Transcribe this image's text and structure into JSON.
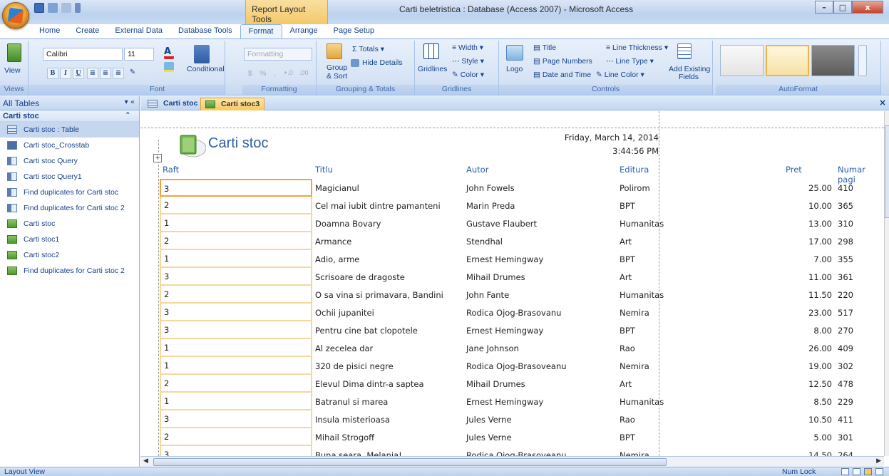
{
  "title_bar": {
    "context_label": "Report Layout Tools",
    "window_title": "Carti beletristica : Database (Access 2007) - Microsoft Access"
  },
  "ribbon_tabs": [
    "Home",
    "Create",
    "External Data",
    "Database Tools",
    "Format",
    "Arrange",
    "Page Setup"
  ],
  "active_tab": "Format",
  "ribbon": {
    "views": {
      "view_label": "View",
      "group_label": "Views"
    },
    "font": {
      "font_name": "Calibri",
      "font_size": "11",
      "bold": "B",
      "italic": "I",
      "underline": "U",
      "conditional": "Conditional",
      "group_label": "Font"
    },
    "formatting": {
      "format_combo": "Formatting",
      "currency": "$",
      "percent": "%",
      "comma": ",",
      "inc_dec": "+.0",
      "dec_dec": ".00",
      "group_label": "Formatting"
    },
    "grouping": {
      "totals": "Totals",
      "hide_details": "Hide Details",
      "group_sort_1": "Group",
      "group_sort_2": "& Sort",
      "group_label": "Grouping & Totals"
    },
    "gridlines": {
      "gridlines": "Gridlines",
      "width": "Width",
      "style": "Style",
      "color": "Color",
      "group_label": "Gridlines"
    },
    "controls": {
      "logo": "Logo",
      "title": "Title",
      "page_numbers": "Page Numbers",
      "date_time": "Date and Time",
      "line_thickness": "Line Thickness",
      "line_type": "Line Type",
      "line_color": "Line Color",
      "add_fields_1": "Add Existing",
      "add_fields_2": "Fields",
      "group_label": "Controls"
    },
    "autoformat": {
      "group_label": "AutoFormat"
    }
  },
  "nav": {
    "header": "All Tables",
    "group": "Carti stoc",
    "items": [
      {
        "label": "Carti stoc : Table",
        "type": "table",
        "selected": true
      },
      {
        "label": "Carti stoc_Crosstab",
        "type": "xtab"
      },
      {
        "label": "Carti stoc Query",
        "type": "query"
      },
      {
        "label": "Carti stoc Query1",
        "type": "query"
      },
      {
        "label": "Find duplicates for Carti stoc",
        "type": "query"
      },
      {
        "label": "Find duplicates for Carti stoc 2",
        "type": "query"
      },
      {
        "label": "Carti stoc",
        "type": "report"
      },
      {
        "label": "Carti stoc1",
        "type": "report"
      },
      {
        "label": "Carti stoc2",
        "type": "report"
      },
      {
        "label": "Find duplicates for Carti stoc 2",
        "type": "report"
      }
    ]
  },
  "doc_tabs": [
    "Carti stoc",
    "Carti stoc3"
  ],
  "report": {
    "title": "Carti stoc",
    "date": "Friday, March 14, 2014",
    "time": "3:44:56 PM",
    "columns": [
      "Raft",
      "Titlu",
      "Autor",
      "Editura",
      "Pret",
      "Numar pagi"
    ],
    "rows": [
      [
        "3",
        "Magicianul",
        "John Fowels",
        "Polirom",
        "25.00",
        "410"
      ],
      [
        "2",
        "Cel mai iubit dintre pamanteni",
        "Marin Preda",
        "BPT",
        "10.00",
        "365"
      ],
      [
        "1",
        "Doamna Bovary",
        "Gustave Flaubert",
        "Humanitas",
        "13.00",
        "310"
      ],
      [
        "2",
        "Armance",
        "Stendhal",
        "Art",
        "17.00",
        "298"
      ],
      [
        "1",
        "Adio, arme",
        "Ernest Hemingway",
        "BPT",
        "7.00",
        "355"
      ],
      [
        "3",
        "Scrisoare de dragoste",
        "Mihail Drumes",
        "Art",
        "11.00",
        "361"
      ],
      [
        "2",
        "O sa vina si primavara, Bandini",
        "John Fante",
        "Humanitas",
        "11.50",
        "220"
      ],
      [
        "3",
        "Ochii jupanitei",
        "Rodica Ojog-Brasovanu",
        "Nemira",
        "23.00",
        "517"
      ],
      [
        "3",
        "Pentru cine bat clopotele",
        "Ernest Hemingway",
        "BPT",
        "8.00",
        "270"
      ],
      [
        "1",
        "Al zecelea dar",
        "Jane Johnson",
        "Rao",
        "26.00",
        "409"
      ],
      [
        "1",
        "320 de pisici negre",
        "Rodica Ojog-Brasoveanu",
        "Nemira",
        "19.00",
        "302"
      ],
      [
        "2",
        "Elevul Dima dintr-a saptea",
        "Mihail Drumes",
        "Art",
        "12.50",
        "478"
      ],
      [
        "1",
        "Batranul si marea",
        "Ernest Hemingway",
        "Humanitas",
        "8.50",
        "229"
      ],
      [
        "3",
        "Insula misterioasa",
        "Jules Verne",
        "Rao",
        "10.50",
        "411"
      ],
      [
        "2",
        "Mihail Strogoff",
        "Jules Verne",
        "BPT",
        "5.00",
        "301"
      ],
      [
        "3",
        "Buna seara, Melania!",
        "Rodica Ojog-Brasoveanu",
        "Nemira",
        "14.50",
        "264"
      ]
    ]
  },
  "status": {
    "left": "Layout View",
    "right": "Num Lock"
  }
}
